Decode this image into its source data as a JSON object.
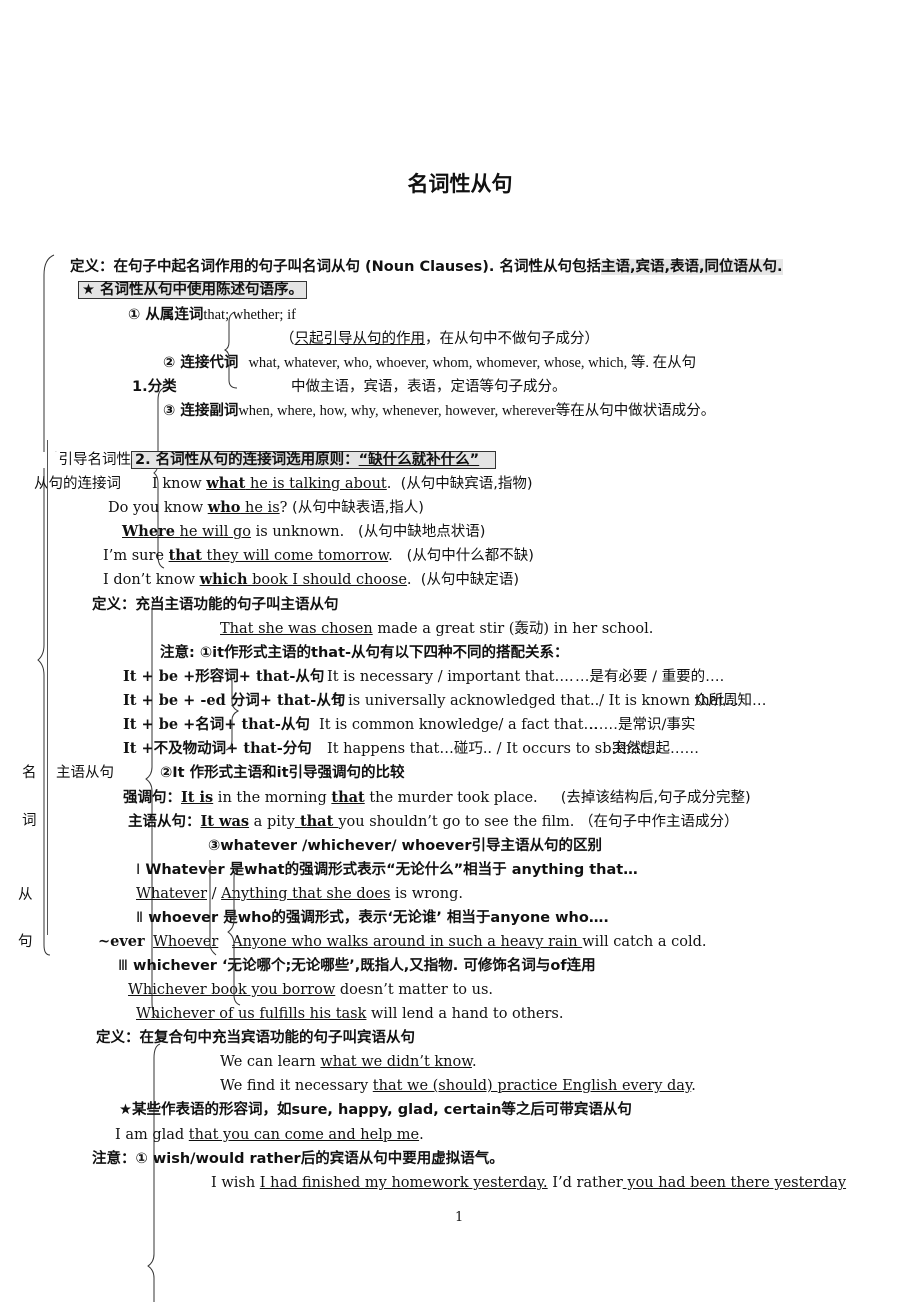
{
  "title": "名词性从句",
  "left_label": [
    "名",
    "词",
    "从",
    "句"
  ],
  "definition": {
    "prefix": "定义：在句子中起名词作用的句子叫名词从句 (Noun Clauses). 名词性从句包括",
    "highlighted": "主语,宾语,表语,同位语从句."
  },
  "star_note": "★ 名词性从句中使用陈述句语序。",
  "classification": {
    "label": "1.分类",
    "item1_label": "① 从属连词",
    "item1_words": "that; whether; if",
    "item1_note_underlined": "只起引导从句的作用",
    "item1_note_rest": "，在从句中不做句子成分）",
    "item1_note_open": "（",
    "item2_label": "② 连接代词",
    "item2_words": "what, whatever, who, whoever, whom, whomever, whose, which, 等. 在从句",
    "item2_line2": "中做主语，宾语，表语，定语等句子成分。",
    "item3_label": "③ 连接副词",
    "item3_words": "when, where, how, why, whenever, however, wherever",
    "item3_rest": "等在从句中做状语成分。"
  },
  "connectives": {
    "side_label_1": "引导名词性",
    "side_label_2": "从句的连接词",
    "principle_prefix": "2. 名词性从句的连接词选用原则：",
    "principle_quote": "“缺什么就补什么”",
    "examples": [
      {
        "pre": "I know ",
        "bold": "what",
        "under": " he is talking about",
        "post": ".",
        "note": "(从句中缺宾语,指物)"
      },
      {
        "pre": "Do you know ",
        "bold": "who",
        "under": " he is",
        "post": "?",
        "note": "(从句中缺表语,指人)"
      },
      {
        "pre": "",
        "bold": "Where",
        "under": " he will go",
        "post": " is unknown.",
        "note": "(从句中缺地点状语)"
      },
      {
        "pre": "I’m sure ",
        "bold": "that",
        "under": " they will come tomorrow",
        "post": ".",
        "note": "(从句中什么都不缺)"
      },
      {
        "pre": "I don’t know ",
        "bold": "which",
        "under": " book I should choose",
        "post": ".",
        "note": "(从句中缺定语)"
      }
    ]
  },
  "subject_clause": {
    "side_label": "主语从句",
    "definition": "定义：充当主语功能的句子叫主语从句",
    "example_under": "That she was chosen",
    "example_rest": " made a great stir (轰动) in her school.",
    "note1_prefix": "注意: ①it作形式主语的that-从句有以下四种不同的搭配关系：",
    "patterns": [
      {
        "formula": "It + be +形容词+ that-从句",
        "example": "It is necessary / important that….",
        "meaning": "…是有必要 / 重要的…."
      },
      {
        "formula": "It + be + -ed 分词+ that-从句",
        "example": "It is universally acknowledged that../ It is known that…",
        "meaning": "众所周知…"
      },
      {
        "formula": "It + be +名词+ that-从句",
        "example": "It is common knowledge/ a fact that…",
        "meaning": "……是常识/事实"
      },
      {
        "formula": "It +不及物动词+ that-分句",
        "example": "It happens that…碰巧.. / It occurs to sb.that…",
        "meaning": "突然想起……"
      }
    ],
    "note2": "②It 作形式主语和it引导强调句的比较",
    "emphasis_label": "强调句：",
    "emphasis_b1": "It is",
    "emphasis_mid": " in the morning ",
    "emphasis_b2": "that",
    "emphasis_rest": " the murder took place.",
    "emphasis_note": "(去掉该结构后,句子成分完整)",
    "subject_label": "主语从句：",
    "subject_b1": "It was",
    "subject_mid": " a pity",
    "subject_b2": " that ",
    "subject_rest": "you shouldn’t go to see the film.",
    "subject_note": "（在句子中作主语成分）",
    "note3": "③whatever /whichever/ whoever引导主语从句的区别",
    "ever_label": "~ever",
    "whatever_head_num": "Ⅰ",
    "whatever_head": " Whatever 是what的强调形式表示“无论什么”相当于 anything that…",
    "whatever_ex_u1": "Whatever",
    "whatever_ex_sep": " / ",
    "whatever_ex_u2": "Anything that she does",
    "whatever_ex_rest": " is wrong.",
    "whoever_head_num": "Ⅱ",
    "whoever_head": " whoever 是who的强调形式，表示‘无论谁’ 相当于anyone who….",
    "whoever_ex_u1": "Whoever",
    "whoever_ex_u2": "Anyone who walks around in such a heavy rain ",
    "whoever_ex_rest": "will catch a cold.",
    "whichever_head_num": "Ⅲ",
    "whichever_head": " whichever ‘无论哪个;无论哪些’,既指人,又指物. 可修饰名词与of连用",
    "whichever_ex1_u": "Whichever book you borrow",
    "whichever_ex1_rest": " doesn’t matter to us.",
    "whichever_ex2_u": "Whichever of us fulfills his task",
    "whichever_ex2_rest": " will lend a hand to others."
  },
  "object_clause": {
    "definition": "定义：在复合句中充当宾语功能的句子叫宾语从句",
    "ex1_pre": "We can learn ",
    "ex1_u": "what we didn’t know",
    "ex1_post": ".",
    "ex2_pre": "We find it necessary ",
    "ex2_u": "that we (should) practice English every day",
    "ex2_post": ".",
    "star_note": "★某些作表语的形容词，如sure, happy, glad, certain等之后可带宾语从句",
    "ex3_pre": "I am glad ",
    "ex3_u": "that you can come and help me",
    "ex3_post": ".",
    "note": "注意：① wish/would rather后的宾语从句中要用虚拟语气。",
    "ex4_pre": "I wish ",
    "ex4_u": "I had finished my homework yesterday.",
    "ex4_mid": "  I’d rather",
    "ex4_u2": " you had been there yesterday"
  },
  "page_number": "1"
}
